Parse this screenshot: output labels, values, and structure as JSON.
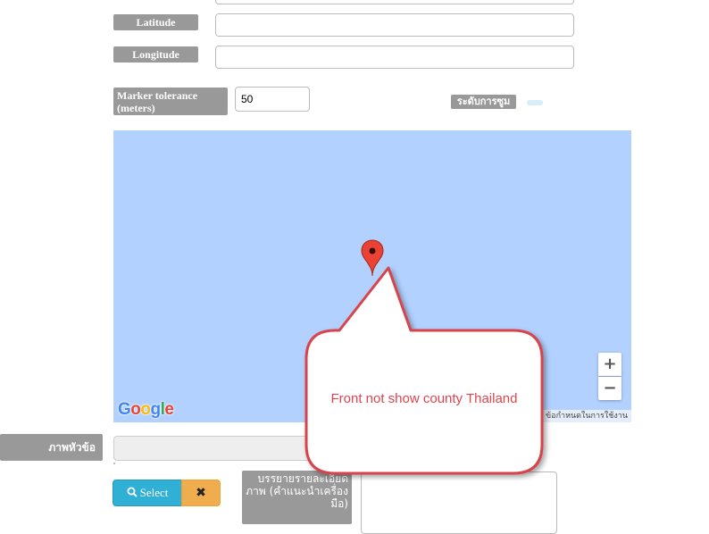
{
  "form": {
    "latitude_label": "Latitude",
    "latitude_value": "",
    "longitude_label": "Longitude",
    "longitude_value": "",
    "marker_tolerance_label": "Marker tolerance (meters)",
    "marker_tolerance_value": "50",
    "zoom_level_label": "ระดับการซูม",
    "headline_image_label": "ภาพหัวข้อ",
    "image_description_label": "บรรยายรายละเอียดภาพ (คำแนะนำเครื่องมือ)",
    "select_button_label": "Select",
    "remove_button_label": "✖"
  },
  "map": {
    "zoom_in_label": "+",
    "zoom_out_label": "−",
    "terms_text": "ข้อกำหนดในการใช้งาน",
    "logo_letters": [
      "G",
      "o",
      "o",
      "g",
      "l",
      "e"
    ]
  },
  "annotation": {
    "text": "Front not show county Thailand"
  },
  "colors": {
    "map_water": "#b3d1ff",
    "label_gray": "#999999",
    "select_button": "#31b0d5",
    "remove_button": "#f0ad4e",
    "callout_border": "#d9434b",
    "callout_text": "#e0444c"
  }
}
